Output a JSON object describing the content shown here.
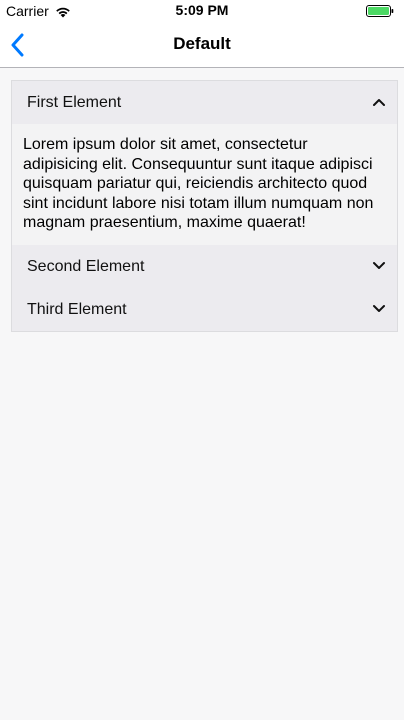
{
  "status_bar": {
    "carrier": "Carrier",
    "time": "5:09 PM",
    "wifi_icon": "wifi-icon",
    "battery_icon": "battery-icon",
    "battery_color": "#4cd964"
  },
  "nav": {
    "title": "Default",
    "back_icon": "chevron-left-icon",
    "accent_color": "#007aff"
  },
  "accordion": {
    "items": [
      {
        "label": "First Element",
        "expanded": true,
        "icon": "chevron-up-icon",
        "content": "Lorem ipsum dolor sit amet, consectetur adipisicing elit. Consequuntur sunt itaque adipisci quisquam pariatur qui, reiciendis architecto quod sint incidunt labore nisi totam illum numquam non magnam praesentium, maxime quaerat!"
      },
      {
        "label": "Second Element",
        "expanded": false,
        "icon": "chevron-down-icon"
      },
      {
        "label": "Third Element",
        "expanded": false,
        "icon": "chevron-down-icon"
      }
    ]
  }
}
